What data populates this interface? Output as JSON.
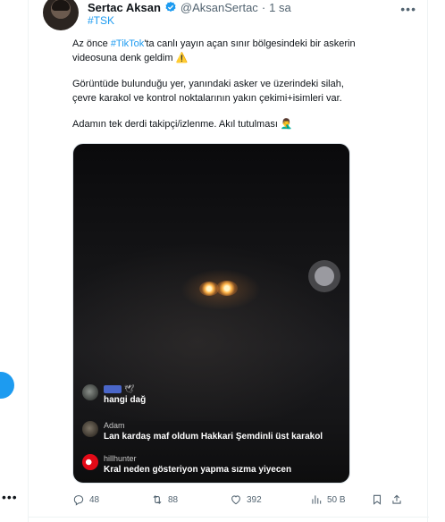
{
  "tweet": {
    "author_name": "Sertac Aksan",
    "author_handle": "@AksanSertac",
    "separator": "·",
    "time": "1 sa",
    "hashtag": "#TSK",
    "para1_pre": "Az önce ",
    "para1_link": "#TikTok",
    "para1_post": "'ta canlı yayın açan sınır bölgesindeki bir askerin videosuna denk geldim ⚠️",
    "para2": "Görüntüde bulunduğu yer, yanındaki asker ve üzerindeki silah, çevre karakol ve kontrol noktalarının yakın çekimi+isimleri var.",
    "para3": "Adamın tek derdi takipçi/izlenme. Akıl tutulması 🤦‍♂️"
  },
  "video": {
    "comments": [
      {
        "user": "",
        "message": "hangi dağ",
        "avatar": "moon"
      },
      {
        "user": "Adam",
        "message": "Lan kardaş maf oldum Hakkari Şemdinli üst karakol",
        "avatar": "stone"
      },
      {
        "user": "hillhunter",
        "message": "Kral neden gösteriyon yapma sızma yiyecen",
        "avatar": "flag"
      }
    ]
  },
  "actions": {
    "replies": "48",
    "reposts": "88",
    "likes": "392",
    "views": "50 B"
  },
  "icons": {
    "verified": "verified-badge-icon",
    "more": "more-dots-icon",
    "reply": "reply-icon",
    "repost": "repost-icon",
    "like": "heart-icon",
    "views": "views-icon",
    "bookmark": "bookmark-icon",
    "share": "share-icon"
  },
  "colors": {
    "accent": "#1d9bf0",
    "muted": "#536471",
    "text": "#0f1419"
  }
}
